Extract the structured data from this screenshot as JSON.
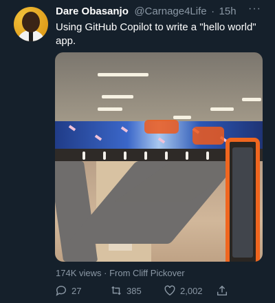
{
  "tweet": {
    "author_name": "Dare Obasanjo",
    "handle": "@Carnage4Life",
    "separator": "·",
    "time": "15h",
    "more_label": "···",
    "text": "Using GitHub Copilot to write a \"hello world\" app.",
    "views": "174K views",
    "meta_separator": "·",
    "source": "From Cliff Pickover",
    "replies": "27",
    "retweets": "385",
    "likes": "2,002"
  },
  "icons": {
    "reply": "reply-icon",
    "retweet": "retweet-icon",
    "like": "like-icon",
    "share": "share-icon"
  },
  "colors": {
    "background": "#15202b",
    "secondary_text": "#8b98a5",
    "accent": "#f0661f"
  }
}
